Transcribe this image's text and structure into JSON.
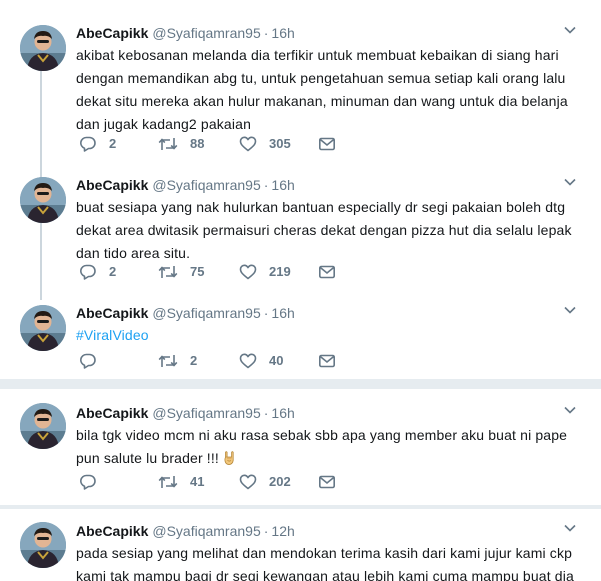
{
  "colors": {
    "background": "#e6ecf0",
    "card": "#ffffff",
    "text": "#14171a",
    "muted": "#657786",
    "link": "#1da1f2",
    "thread_line": "#ccd6dd"
  },
  "icons": {
    "reply": "reply-icon",
    "retweet": "retweet-icon",
    "like": "like-icon",
    "message": "mail-icon",
    "menu": "chevron-down-icon"
  },
  "tweets": [
    {
      "name": "AbeCapikk",
      "handle": "@Syafiqamran95",
      "dot": "·",
      "time": "16h",
      "text": "akibat kebosanan melanda dia terfikir untuk membuat kebaikan di siang hari dengan memandikan abg tu, untuk pengetahuan semua setiap kali orang lalu dekat situ mereka akan hulur makanan, minuman dan wang untuk dia belanja dan jugak kadang2 pakaian",
      "replies": "2",
      "retweets": "88",
      "likes": "305"
    },
    {
      "name": "AbeCapikk",
      "handle": "@Syafiqamran95",
      "dot": "·",
      "time": "16h",
      "text": "buat sesiapa yang nak hulurkan bantuan especially dr segi pakaian boleh dtg dekat area dwitasik permaisuri cheras dekat dengan pizza hut dia selalu lepak dan tido area situ.",
      "replies": "2",
      "retweets": "75",
      "likes": "219"
    },
    {
      "name": "AbeCapikk",
      "handle": "@Syafiqamran95",
      "dot": "·",
      "time": "16h",
      "text": "#ViralVideo",
      "replies": "",
      "retweets": "2",
      "likes": "40"
    },
    {
      "name": "AbeCapikk",
      "handle": "@Syafiqamran95",
      "dot": "·",
      "time": "16h",
      "text": "bila tgk video mcm ni aku rasa sebak sbb apa yang member aku buat ni pape pun salute lu brader !!!",
      "emoji": "rock-on-hand",
      "replies": "",
      "retweets": "41",
      "likes": "202"
    },
    {
      "name": "AbeCapikk",
      "handle": "@Syafiqamran95",
      "dot": "·",
      "time": "12h",
      "text": "pada sesiap yang melihat dan mendokan terima kasih dari kami jujur kami ckp kami tak mampu bagi dr segi kewangan atau lebih kami cuma mampu buat dia"
    }
  ]
}
